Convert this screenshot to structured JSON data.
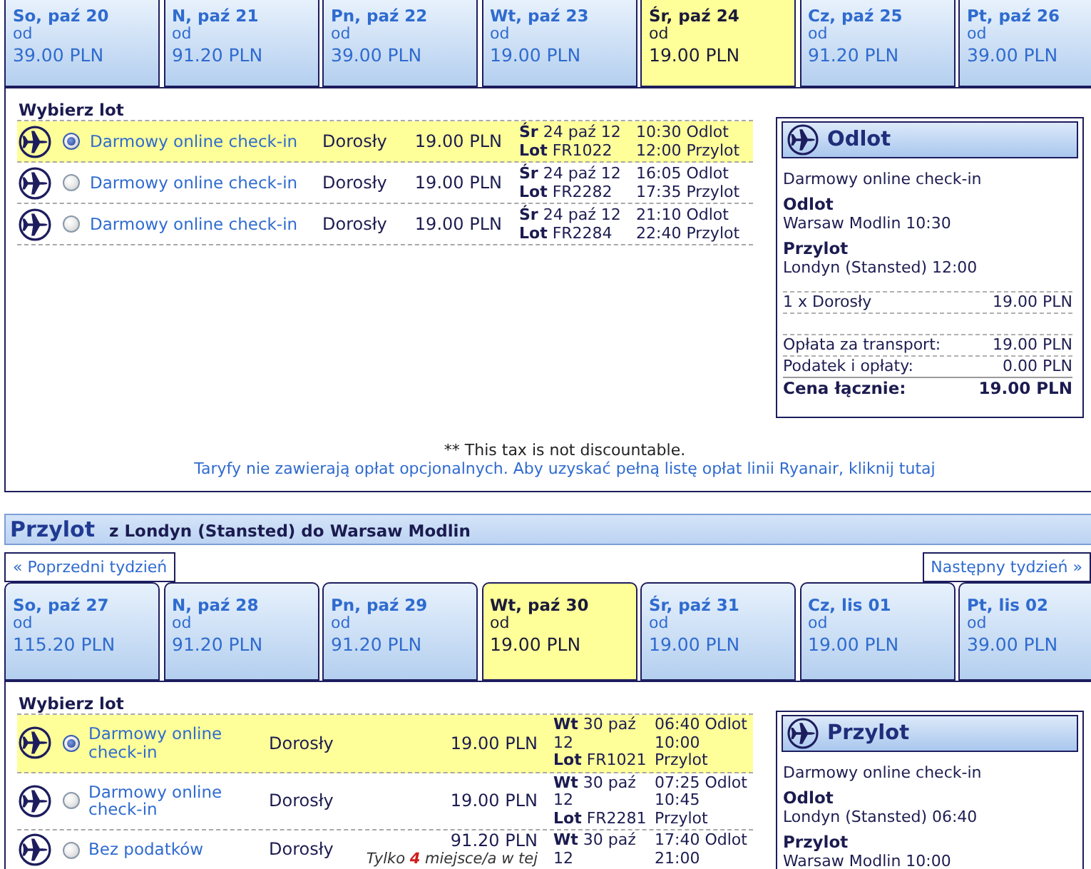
{
  "outbound": {
    "days": [
      {
        "day": "So, paź 20",
        "from": "od",
        "price": "39.00 PLN",
        "selected": false
      },
      {
        "day": "N, paź 21",
        "from": "od",
        "price": "91.20 PLN",
        "selected": false
      },
      {
        "day": "Pn, paź 22",
        "from": "od",
        "price": "39.00 PLN",
        "selected": false
      },
      {
        "day": "Wt, paź 23",
        "from": "od",
        "price": "19.00 PLN",
        "selected": false
      },
      {
        "day": "Śr, paź 24",
        "from": "od",
        "price": "19.00 PLN",
        "selected": true
      },
      {
        "day": "Cz, paź 25",
        "from": "od",
        "price": "91.20 PLN",
        "selected": false
      },
      {
        "day": "Pt, paź 26",
        "from": "od",
        "price": "39.00 PLN",
        "selected": false
      }
    ],
    "heading": "Wybierz lot",
    "flights": [
      {
        "fare": "Darmowy online check-in",
        "passenger": "Dorosły",
        "price": "19.00 PLN",
        "date": "**Śr** 24 paź 12",
        "flight": "**Lot** FR1022",
        "departs": "10:30 Odlot",
        "arrives": "12:00 Przylot",
        "selected": true
      },
      {
        "fare": "Darmowy online check-in",
        "passenger": "Dorosły",
        "price": "19.00 PLN",
        "date": "**Śr** 24 paź 12",
        "flight": "**Lot** FR2282",
        "departs": "16:05 Odlot",
        "arrives": "17:35 Przylot",
        "selected": false
      },
      {
        "fare": "Darmowy online check-in",
        "passenger": "Dorosły",
        "price": "19.00 PLN",
        "date": "**Śr** 24 paź 12",
        "flight": "**Lot** FR2284",
        "departs": "21:10 Odlot",
        "arrives": "22:40 Przylot",
        "selected": false
      }
    ],
    "summary": {
      "title": "Odlot",
      "fare": "Darmowy online check-in",
      "stops": [
        {
          "label": "Odlot",
          "value": "Warsaw Modlin 10:30"
        },
        {
          "label": "Przylot",
          "value": "Londyn (Stansted) 12:00"
        }
      ],
      "items": [
        {
          "label": "1 x Dorosły",
          "amount": "19.00 PLN"
        }
      ],
      "charges": [
        {
          "label": "Opłata za transport:",
          "amount": "19.00 PLN"
        },
        {
          "label": "Podatek i opłaty:",
          "amount": "0.00 PLN"
        }
      ],
      "total": {
        "label": "Cena łącznie:",
        "amount": "19.00 PLN"
      }
    },
    "tax_note": "** This tax is not discountable.",
    "fees_link": "Taryfy nie zawierają opłat opcjonalnych. Aby uzyskać pełną listę opłat linii Ryanair, kliknij tutaj"
  },
  "inbound": {
    "title": "Przylot",
    "route": "z Londyn (Stansted) do Warsaw Modlin",
    "prev_week": "« Poprzedni tydzień",
    "next_week": "Następny tydzień »",
    "days": [
      {
        "day": "So, paź 27",
        "from": "od",
        "price": "115.20 PLN",
        "selected": false
      },
      {
        "day": "N, paź 28",
        "from": "od",
        "price": "91.20 PLN",
        "selected": false
      },
      {
        "day": "Pn, paź 29",
        "from": "od",
        "price": "91.20 PLN",
        "selected": false
      },
      {
        "day": "Wt, paź 30",
        "from": "od",
        "price": "19.00 PLN",
        "selected": true
      },
      {
        "day": "Śr, paź 31",
        "from": "od",
        "price": "19.00 PLN",
        "selected": false
      },
      {
        "day": "Cz, lis 01",
        "from": "od",
        "price": "19.00 PLN",
        "selected": false
      },
      {
        "day": "Pt, lis 02",
        "from": "od",
        "price": "39.00 PLN",
        "selected": false
      }
    ],
    "heading": "Wybierz lot",
    "flights": [
      {
        "fare": "Darmowy online check-in",
        "passenger": "Dorosły",
        "price": "19.00 PLN",
        "date": "**Wt** 30 paź 12",
        "flight": "**Lot** FR1021",
        "departs": "06:40 Odlot",
        "arrives": "10:00 Przylot",
        "selected": true
      },
      {
        "fare": "Darmowy online check-in",
        "passenger": "Dorosły",
        "price": "19.00 PLN",
        "date": "**Wt** 30 paź 12",
        "flight": "**Lot** FR2281",
        "departs": "07:25 Odlot",
        "arrives": "10:45 Przylot",
        "selected": false
      },
      {
        "fare": "Bez podatków",
        "passenger": "Dorosły",
        "price": "91.20 PLN",
        "note": "Tylko **4** miejsce/a w tej",
        "date": "**Wt** 30 paź 12",
        "departs": "17:40 Odlot",
        "arrives": "21:00",
        "selected": false
      }
    ],
    "summary": {
      "title": "Przylot",
      "fare": "Darmowy online check-in",
      "stops": [
        {
          "label": "Odlot",
          "value": "Londyn (Stansted) 06:40"
        },
        {
          "label": "Przylot",
          "value": "Warsaw Modlin 10:00"
        }
      ]
    }
  }
}
